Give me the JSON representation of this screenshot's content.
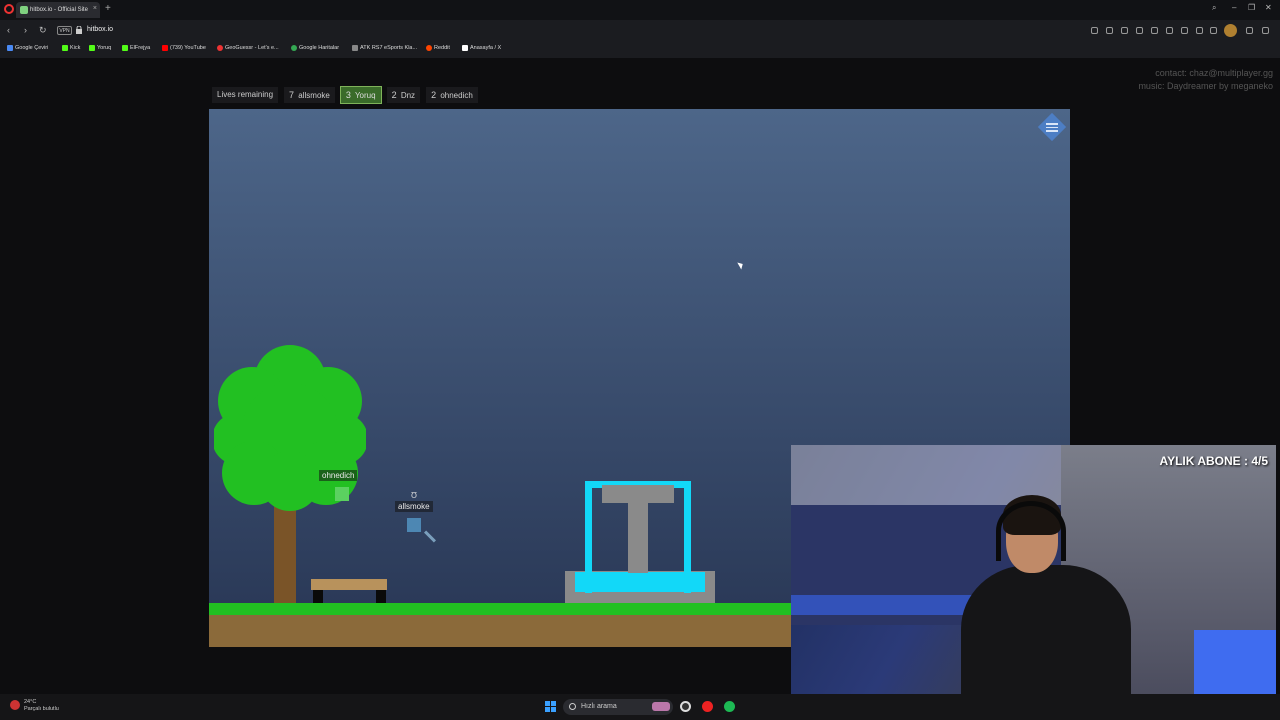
{
  "browser": {
    "tab_title": "hitbox.io - Official Site",
    "url": "hitbox.io",
    "vpn_label": "VPN",
    "bookmarks": [
      {
        "label": "Google Çeviri",
        "color": "#4a8af4"
      },
      {
        "label": "Kick",
        "color": "#53fc18"
      },
      {
        "label": "Yoruq",
        "color": "#53fc18"
      },
      {
        "label": "ElFrejya",
        "color": "#53fc18"
      },
      {
        "label": "(739) YouTube",
        "color": "#ff0000"
      },
      {
        "label": "GeoGuessr - Let's e...",
        "color": "#e33"
      },
      {
        "label": "Google Haritalar",
        "color": "#34a853"
      },
      {
        "label": "ATK RS7 eSports Kla...",
        "color": "#888"
      },
      {
        "label": "Reddit",
        "color": "#ff4500"
      },
      {
        "label": "Anasayfa / X",
        "color": "#ffffff"
      }
    ]
  },
  "page": {
    "contact": "contact: chaz@multiplayer.gg",
    "music": "music: Daydreamer by meganeko",
    "lives_label": "Lives remaining",
    "lives": [
      {
        "count": "7",
        "name": "allsmoke",
        "active": false
      },
      {
        "count": "3",
        "name": "Yoruq",
        "active": true
      },
      {
        "count": "2",
        "name": "Dnz",
        "active": false
      },
      {
        "count": "2",
        "name": "ohnedich",
        "active": false
      }
    ]
  },
  "game": {
    "players": [
      {
        "name": "ohnedich"
      },
      {
        "name": "allsmoke"
      }
    ]
  },
  "webcam": {
    "sub_counter": "AYLIK ABONE : 4/5"
  },
  "taskbar": {
    "temperature": "24°C",
    "weather": "Parçalı bulutlu",
    "search_placeholder": "Hızlı arama"
  }
}
